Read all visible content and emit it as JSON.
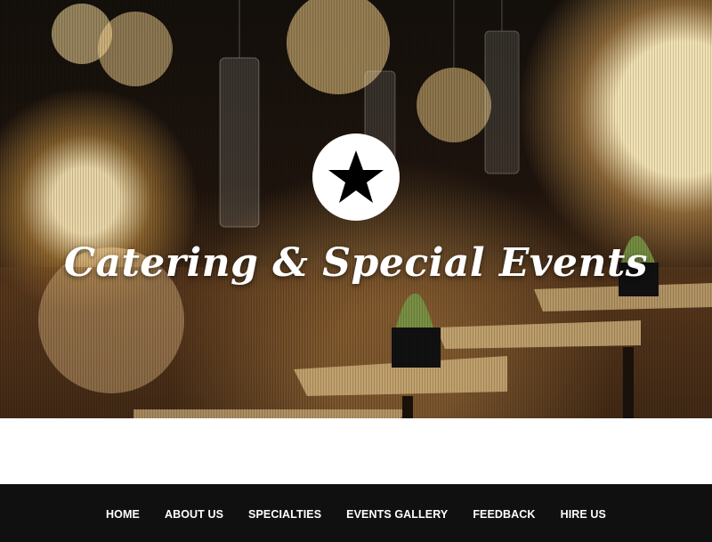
{
  "hero": {
    "title": "Catering & Special Events",
    "emblem_icon": "star-icon"
  },
  "nav": {
    "items": [
      {
        "label": "HOME"
      },
      {
        "label": "ABOUT US"
      },
      {
        "label": "SPECIALTIES"
      },
      {
        "label": "EVENTS GALLERY"
      },
      {
        "label": "FEEDBACK"
      },
      {
        "label": "HIRE US"
      }
    ]
  },
  "colors": {
    "nav_background": "#101010",
    "nav_text": "#ffffff",
    "page_background": "#ffffff",
    "emblem_background": "#ffffff",
    "emblem_star": "#000000"
  }
}
